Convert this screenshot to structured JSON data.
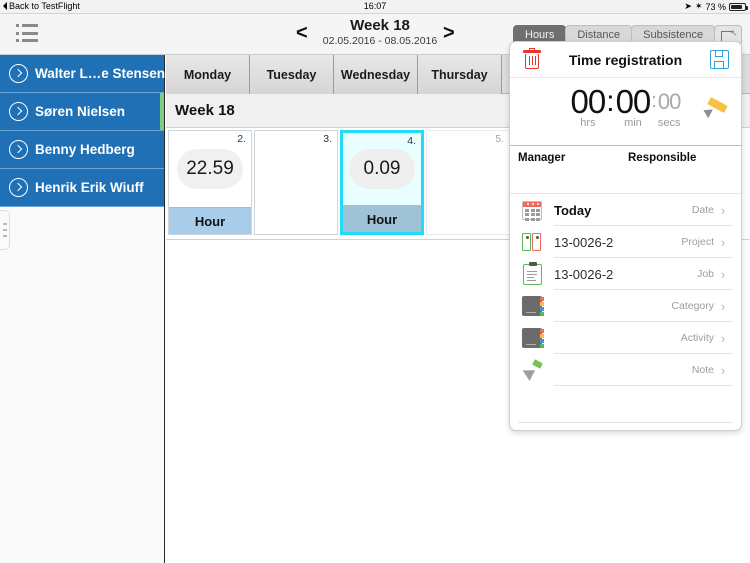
{
  "statusbar": {
    "back_label": "Back to TestFlight",
    "time": "16:07",
    "battery_percent": "73 %",
    "location_icon": "➤",
    "bluetooth_icon": "✶"
  },
  "navbar": {
    "menu_icon": "list-icon",
    "prev_arrow": "<",
    "next_arrow": ">",
    "week_title": "Week 18",
    "week_range": "02.05.2016 - 08.05.2016"
  },
  "sidebar": {
    "employees": [
      {
        "name": "Walter L…e Stensen",
        "accent": false
      },
      {
        "name": "Søren Nielsen",
        "accent": true
      },
      {
        "name": "Benny Hedberg",
        "accent": false
      },
      {
        "name": "Henrik Erik Wiuff",
        "accent": false
      }
    ],
    "accent_color": "#7ed07e",
    "row_color": "#1f70b5"
  },
  "calendar": {
    "days": [
      "Monday",
      "Tuesday",
      "Wednesday",
      "Thursday"
    ],
    "week_label": "Week 18",
    "cards": [
      {
        "daynum": "2.",
        "value": "22.59",
        "unit": "Hour",
        "selected": false,
        "empty": false,
        "dim": false
      },
      {
        "daynum": "3.",
        "value": "",
        "unit": "",
        "selected": false,
        "empty": true,
        "dim": false
      },
      {
        "daynum": "4.",
        "value": "0.09",
        "unit": "Hour",
        "selected": true,
        "empty": false,
        "dim": false
      },
      {
        "daynum": "5.",
        "value": "",
        "unit": "",
        "selected": false,
        "empty": true,
        "dim": true
      }
    ],
    "selected_color": "#22dcf5",
    "footer_color": "#a9cde8"
  },
  "tabs": [
    {
      "label": "Hours",
      "active": true
    },
    {
      "label": "Distance",
      "active": false
    },
    {
      "label": "Subsistence",
      "active": false
    }
  ],
  "tab_icon_name": "detach-window-icon",
  "panel": {
    "title": "Time registration",
    "delete_icon": "trash-icon",
    "save_icon": "floppy-save-icon",
    "timer": {
      "hours": "00",
      "minutes": "00",
      "seconds": "00",
      "hours_label": "hrs",
      "minutes_label": "min",
      "seconds_label": "secs",
      "colon": ":",
      "edit_icon": "pencil-icon"
    },
    "assignment": {
      "manager_label": "Manager",
      "manager_value": "",
      "responsible_label": "Responsible",
      "responsible_value": ""
    },
    "fields": [
      {
        "icon": "calendar-icon",
        "value": "Today",
        "label": "Date",
        "chevron": "›"
      },
      {
        "icon": "projects-icon",
        "value": "13-0026-2",
        "label": "Project",
        "chevron": "›"
      },
      {
        "icon": "job-icon",
        "value": "13-0026-2",
        "label": "Job",
        "chevron": "›"
      },
      {
        "icon": "notebook-icon",
        "value": "",
        "label": "Category",
        "chevron": "›"
      },
      {
        "icon": "notebook-icon",
        "value": "",
        "label": "Activity",
        "chevron": "›"
      },
      {
        "icon": "pen-nib-icon",
        "value": "",
        "label": "Note",
        "chevron": "›"
      }
    ]
  }
}
